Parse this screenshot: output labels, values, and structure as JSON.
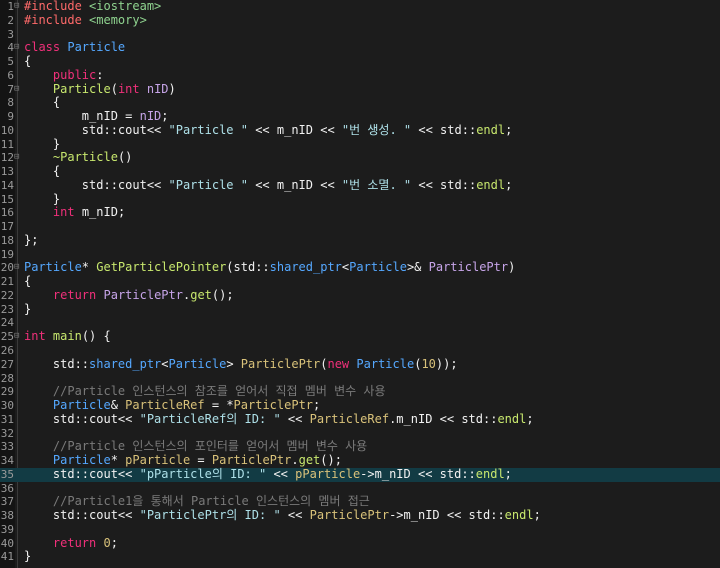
{
  "editor": {
    "current_line": 35,
    "lines": [
      {
        "n": "1",
        "fold": "⊟",
        "segs": [
          {
            "c": "h",
            "t": "#include"
          },
          {
            "c": "o",
            "t": " "
          },
          {
            "c": "pl",
            "t": "<iostream>"
          }
        ]
      },
      {
        "n": "2",
        "fold": "",
        "segs": [
          {
            "c": "h",
            "t": "#include"
          },
          {
            "c": "o",
            "t": " "
          },
          {
            "c": "pl",
            "t": "<memory>"
          }
        ]
      },
      {
        "n": "3",
        "fold": "",
        "segs": []
      },
      {
        "n": "4",
        "fold": "⊟",
        "segs": [
          {
            "c": "k",
            "t": "class"
          },
          {
            "c": "o",
            "t": " "
          },
          {
            "c": "t",
            "t": "Particle"
          }
        ]
      },
      {
        "n": "5",
        "fold": "",
        "segs": [
          {
            "c": "o",
            "t": "{"
          }
        ]
      },
      {
        "n": "6",
        "fold": "",
        "segs": [
          {
            "c": "o",
            "t": "    "
          },
          {
            "c": "k",
            "t": "public"
          },
          {
            "c": "o",
            "t": ":"
          }
        ]
      },
      {
        "n": "7",
        "fold": "⊟",
        "segs": [
          {
            "c": "o",
            "t": "    "
          },
          {
            "c": "f",
            "t": "Particle"
          },
          {
            "c": "o",
            "t": "("
          },
          {
            "c": "k",
            "t": "int"
          },
          {
            "c": "o",
            "t": " "
          },
          {
            "c": "p",
            "t": "nID"
          },
          {
            "c": "o",
            "t": ")"
          }
        ]
      },
      {
        "n": "8",
        "fold": "",
        "segs": [
          {
            "c": "o",
            "t": "    {"
          }
        ]
      },
      {
        "n": "9",
        "fold": "",
        "segs": [
          {
            "c": "o",
            "t": "        m_nID = "
          },
          {
            "c": "p",
            "t": "nID"
          },
          {
            "c": "o",
            "t": ";"
          }
        ]
      },
      {
        "n": "10",
        "fold": "",
        "segs": [
          {
            "c": "o",
            "t": "        std::cout<< "
          },
          {
            "c": "st",
            "t": "\"Particle \""
          },
          {
            "c": "o",
            "t": " << m_nID << "
          },
          {
            "c": "st",
            "t": "\"번 생성. \""
          },
          {
            "c": "o",
            "t": " << std::"
          },
          {
            "c": "f",
            "t": "endl"
          },
          {
            "c": "o",
            "t": ";"
          }
        ]
      },
      {
        "n": "11",
        "fold": "",
        "segs": [
          {
            "c": "o",
            "t": "    }"
          }
        ]
      },
      {
        "n": "12",
        "fold": "⊟",
        "segs": [
          {
            "c": "o",
            "t": "    "
          },
          {
            "c": "f",
            "t": "~Particle"
          },
          {
            "c": "o",
            "t": "()"
          }
        ]
      },
      {
        "n": "13",
        "fold": "",
        "segs": [
          {
            "c": "o",
            "t": "    {"
          }
        ]
      },
      {
        "n": "14",
        "fold": "",
        "segs": [
          {
            "c": "o",
            "t": "        std::cout<< "
          },
          {
            "c": "st",
            "t": "\"Particle \""
          },
          {
            "c": "o",
            "t": " << m_nID << "
          },
          {
            "c": "st",
            "t": "\"번 소멸. \""
          },
          {
            "c": "o",
            "t": " << std::"
          },
          {
            "c": "f",
            "t": "endl"
          },
          {
            "c": "o",
            "t": ";"
          }
        ]
      },
      {
        "n": "15",
        "fold": "",
        "segs": [
          {
            "c": "o",
            "t": "    }"
          }
        ]
      },
      {
        "n": "16",
        "fold": "",
        "segs": [
          {
            "c": "o",
            "t": "    "
          },
          {
            "c": "k",
            "t": "int"
          },
          {
            "c": "o",
            "t": " m_nID;"
          }
        ]
      },
      {
        "n": "17",
        "fold": "",
        "segs": []
      },
      {
        "n": "18",
        "fold": "",
        "segs": [
          {
            "c": "o",
            "t": "};"
          }
        ]
      },
      {
        "n": "19",
        "fold": "",
        "segs": []
      },
      {
        "n": "20",
        "fold": "⊟",
        "segs": [
          {
            "c": "t",
            "t": "Particle"
          },
          {
            "c": "o",
            "t": "* "
          },
          {
            "c": "f",
            "t": "GetParticlePointer"
          },
          {
            "c": "o",
            "t": "(std::"
          },
          {
            "c": "t",
            "t": "shared_ptr"
          },
          {
            "c": "o",
            "t": "<"
          },
          {
            "c": "t",
            "t": "Particle"
          },
          {
            "c": "o",
            "t": ">& "
          },
          {
            "c": "p",
            "t": "ParticlePtr"
          },
          {
            "c": "o",
            "t": ")"
          }
        ]
      },
      {
        "n": "21",
        "fold": "",
        "segs": [
          {
            "c": "o",
            "t": "{"
          }
        ]
      },
      {
        "n": "22",
        "fold": "",
        "segs": [
          {
            "c": "o",
            "t": "    "
          },
          {
            "c": "k",
            "t": "return"
          },
          {
            "c": "o",
            "t": " "
          },
          {
            "c": "p",
            "t": "ParticlePtr"
          },
          {
            "c": "o",
            "t": "."
          },
          {
            "c": "f",
            "t": "get"
          },
          {
            "c": "o",
            "t": "();"
          }
        ]
      },
      {
        "n": "23",
        "fold": "",
        "segs": [
          {
            "c": "o",
            "t": "}"
          }
        ]
      },
      {
        "n": "24",
        "fold": "",
        "segs": []
      },
      {
        "n": "25",
        "fold": "⊟",
        "segs": [
          {
            "c": "k",
            "t": "int"
          },
          {
            "c": "o",
            "t": " "
          },
          {
            "c": "f",
            "t": "main"
          },
          {
            "c": "o",
            "t": "() {"
          }
        ]
      },
      {
        "n": "26",
        "fold": "",
        "segs": []
      },
      {
        "n": "27",
        "fold": "",
        "segs": [
          {
            "c": "o",
            "t": "    std::"
          },
          {
            "c": "t",
            "t": "shared_ptr"
          },
          {
            "c": "o",
            "t": "<"
          },
          {
            "c": "t",
            "t": "Particle"
          },
          {
            "c": "o",
            "t": "> "
          },
          {
            "c": "n",
            "t": "ParticlePtr"
          },
          {
            "c": "o",
            "t": "("
          },
          {
            "c": "k",
            "t": "new"
          },
          {
            "c": "o",
            "t": " "
          },
          {
            "c": "t",
            "t": "Particle"
          },
          {
            "c": "o",
            "t": "("
          },
          {
            "c": "n",
            "t": "10"
          },
          {
            "c": "o",
            "t": "));"
          }
        ]
      },
      {
        "n": "28",
        "fold": "",
        "segs": []
      },
      {
        "n": "29",
        "fold": "",
        "segs": [
          {
            "c": "o",
            "t": "    "
          },
          {
            "c": "c",
            "t": "//Particle 인스턴스의 참조를 얻어서 직접 멤버 변수 사용"
          }
        ]
      },
      {
        "n": "30",
        "fold": "",
        "segs": [
          {
            "c": "o",
            "t": "    "
          },
          {
            "c": "t",
            "t": "Particle"
          },
          {
            "c": "o",
            "t": "& "
          },
          {
            "c": "n",
            "t": "ParticleRef"
          },
          {
            "c": "o",
            "t": " = *"
          },
          {
            "c": "n",
            "t": "ParticlePtr"
          },
          {
            "c": "o",
            "t": ";"
          }
        ]
      },
      {
        "n": "31",
        "fold": "",
        "segs": [
          {
            "c": "o",
            "t": "    std::cout<< "
          },
          {
            "c": "st",
            "t": "\"ParticleRef의 ID: \""
          },
          {
            "c": "o",
            "t": " << "
          },
          {
            "c": "n",
            "t": "ParticleRef"
          },
          {
            "c": "o",
            "t": ".m_nID << std::"
          },
          {
            "c": "f",
            "t": "endl"
          },
          {
            "c": "o",
            "t": ";"
          }
        ]
      },
      {
        "n": "32",
        "fold": "",
        "segs": []
      },
      {
        "n": "33",
        "fold": "",
        "segs": [
          {
            "c": "o",
            "t": "    "
          },
          {
            "c": "c",
            "t": "//Particle 인스턴스의 포인터를 얻어서 멤버 변수 사용"
          }
        ]
      },
      {
        "n": "34",
        "fold": "",
        "segs": [
          {
            "c": "o",
            "t": "    "
          },
          {
            "c": "t",
            "t": "Particle"
          },
          {
            "c": "o",
            "t": "* "
          },
          {
            "c": "n",
            "t": "pParticle"
          },
          {
            "c": "o",
            "t": " = "
          },
          {
            "c": "n",
            "t": "ParticlePtr"
          },
          {
            "c": "o",
            "t": "."
          },
          {
            "c": "f",
            "t": "get"
          },
          {
            "c": "o",
            "t": "();"
          }
        ]
      },
      {
        "n": "35",
        "fold": "",
        "segs": [
          {
            "c": "o",
            "t": "    std::cout<< "
          },
          {
            "c": "st",
            "t": "\"pParticle의 ID: \""
          },
          {
            "c": "o",
            "t": " << "
          },
          {
            "c": "n",
            "t": "pParticle"
          },
          {
            "c": "o",
            "t": "->m_nID << std::"
          },
          {
            "c": "f",
            "t": "endl"
          },
          {
            "c": "o",
            "t": ";"
          }
        ]
      },
      {
        "n": "36",
        "fold": "",
        "segs": []
      },
      {
        "n": "37",
        "fold": "",
        "segs": [
          {
            "c": "o",
            "t": "    "
          },
          {
            "c": "c",
            "t": "//Particle1을 통해서 Particle 인스턴스의 멤버 접근"
          }
        ]
      },
      {
        "n": "38",
        "fold": "",
        "segs": [
          {
            "c": "o",
            "t": "    std::cout<< "
          },
          {
            "c": "st",
            "t": "\"ParticlePtr의 ID: \""
          },
          {
            "c": "o",
            "t": " << "
          },
          {
            "c": "n",
            "t": "ParticlePtr"
          },
          {
            "c": "o",
            "t": "->m_nID << std::"
          },
          {
            "c": "f",
            "t": "endl"
          },
          {
            "c": "o",
            "t": ";"
          }
        ]
      },
      {
        "n": "39",
        "fold": "",
        "segs": []
      },
      {
        "n": "40",
        "fold": "",
        "segs": [
          {
            "c": "o",
            "t": "    "
          },
          {
            "c": "k",
            "t": "return"
          },
          {
            "c": "o",
            "t": " "
          },
          {
            "c": "n",
            "t": "0"
          },
          {
            "c": "o",
            "t": ";"
          }
        ]
      },
      {
        "n": "41",
        "fold": "",
        "segs": [
          {
            "c": "o",
            "t": "}"
          }
        ]
      }
    ]
  }
}
